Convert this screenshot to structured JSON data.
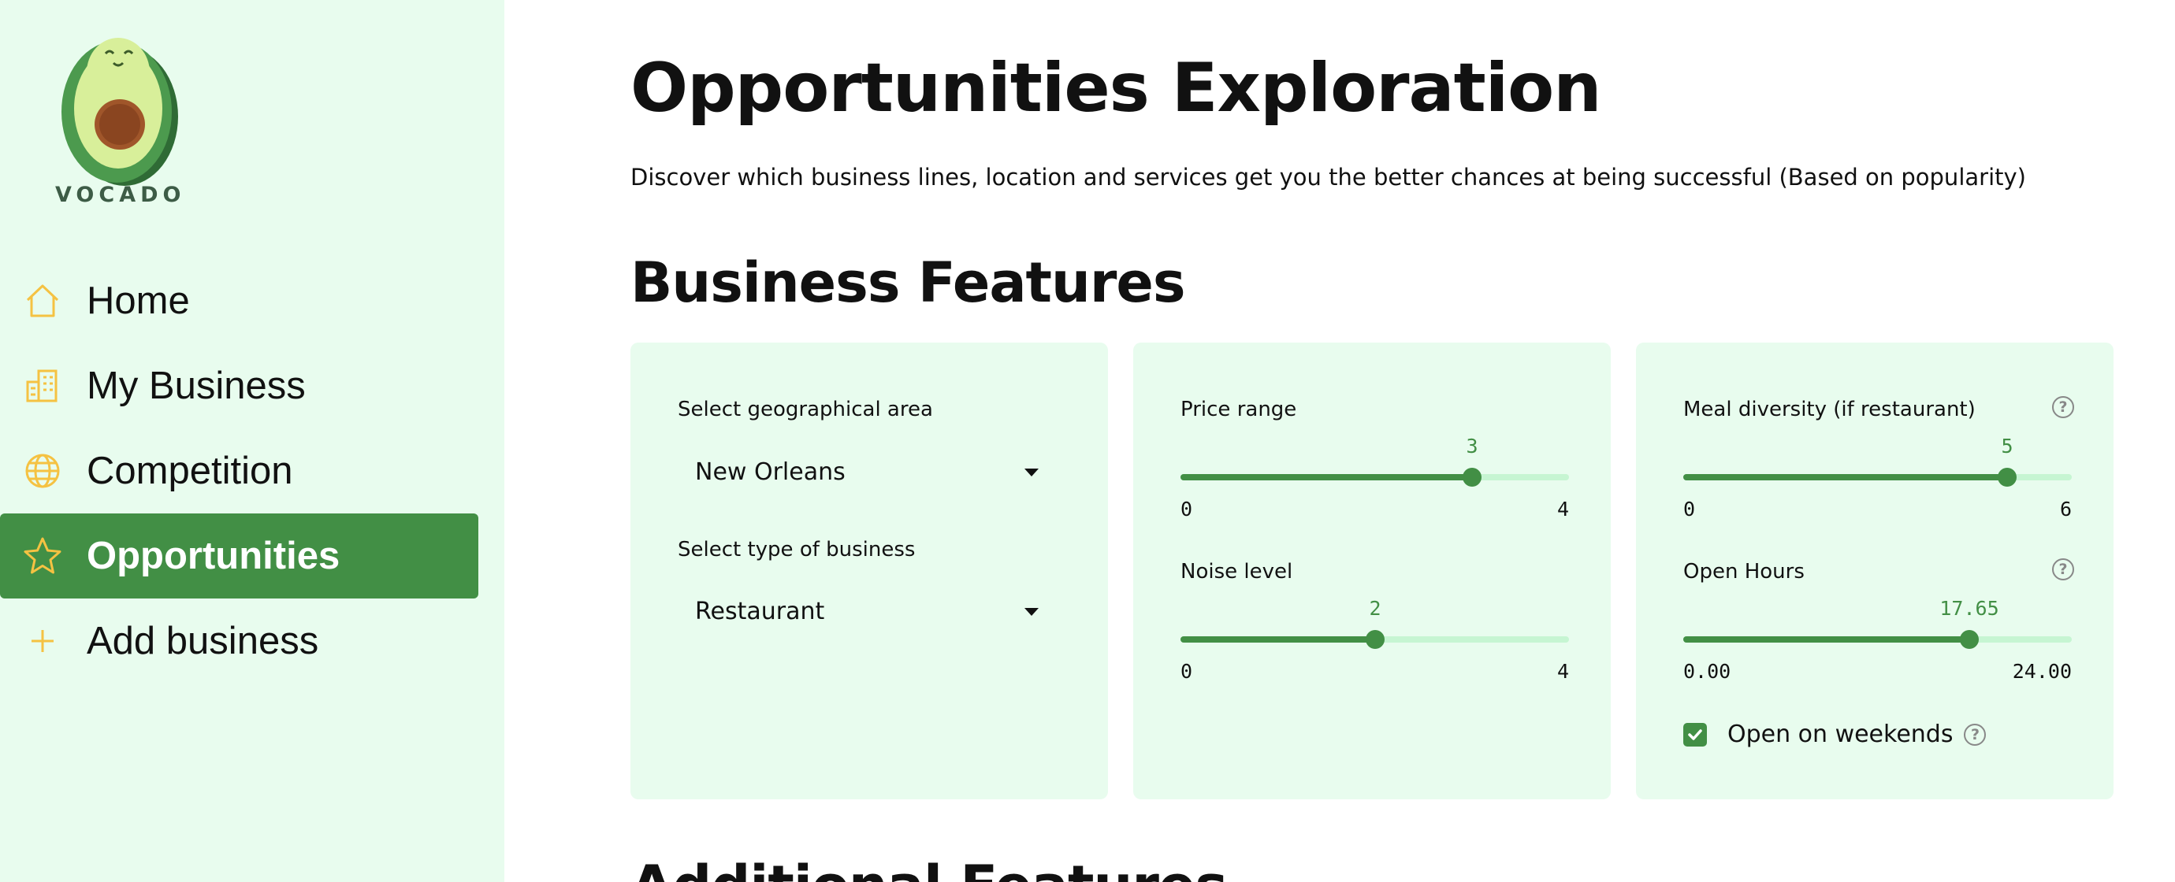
{
  "sidebar": {
    "logo_text": "VOCADO",
    "items": [
      {
        "label": "Home",
        "icon": "house-icon",
        "active": false
      },
      {
        "label": "My Business",
        "icon": "building-icon",
        "active": false
      },
      {
        "label": "Competition",
        "icon": "globe-icon",
        "active": false
      },
      {
        "label": "Opportunities",
        "icon": "star-icon",
        "active": true
      },
      {
        "label": "Add business",
        "icon": "plus-icon",
        "active": false
      }
    ]
  },
  "main": {
    "title": "Opportunities Exploration",
    "subtitle": "Discover which business lines, location and services get you the better chances at being successful (Based on popularity)",
    "section_title": "Business Features",
    "next_section_title": "Additional Features"
  },
  "card1": {
    "geo_label": "Select geographical area",
    "geo_value": "New Orleans",
    "type_label": "Select type of business",
    "type_value": "Restaurant"
  },
  "card2": {
    "price": {
      "label": "Price range",
      "value": "3",
      "min": "0",
      "max": "4"
    },
    "noise": {
      "label": "Noise level",
      "value": "2",
      "min": "0",
      "max": "4"
    }
  },
  "card3": {
    "meal": {
      "label": "Meal diversity (if restaurant)",
      "value": "5",
      "min": "0",
      "max": "6"
    },
    "hours": {
      "label": "Open Hours",
      "value": "17.65",
      "min": "0.00",
      "max": "24.00"
    },
    "weekends": {
      "label": "Open on weekends",
      "checked": true
    }
  },
  "colors": {
    "accent": "#428f45",
    "sidebar_bg": "#e8fcee",
    "track_bg": "#c6f5d2",
    "icon_yellow": "#f5c242"
  }
}
